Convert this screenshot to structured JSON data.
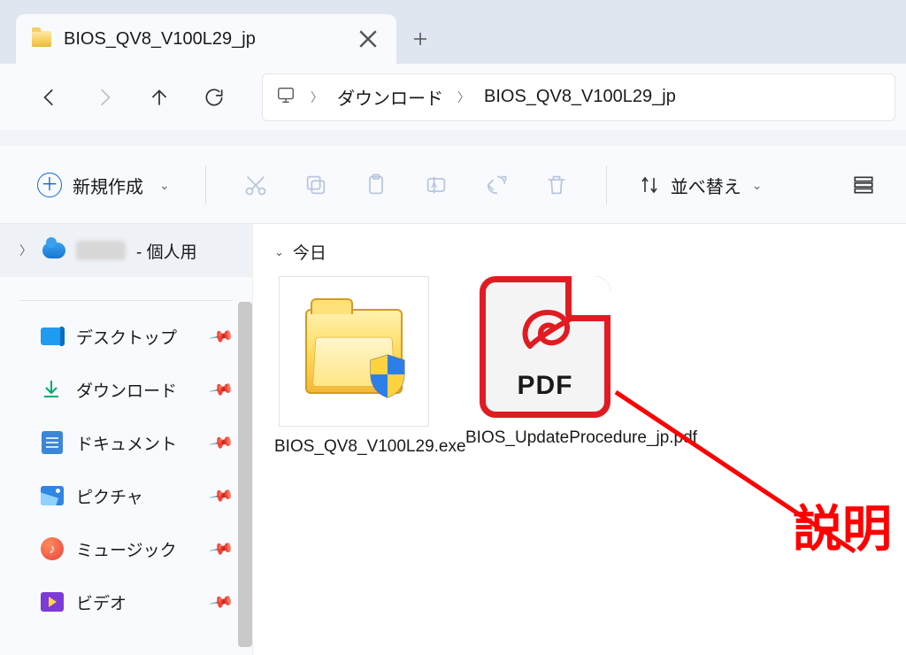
{
  "tab": {
    "title": "BIOS_QV8_V100L29_jp"
  },
  "breadcrumb": {
    "root_icon": "monitor-icon",
    "items": [
      "ダウンロード",
      "BIOS_QV8_V100L29_jp"
    ]
  },
  "toolbar": {
    "new_label": "新規作成",
    "sort_label": "並べ替え"
  },
  "navpane": {
    "top_label": "- 個人用",
    "items": [
      {
        "label": "デスクトップ",
        "icon": "desktop"
      },
      {
        "label": "ダウンロード",
        "icon": "download"
      },
      {
        "label": "ドキュメント",
        "icon": "document"
      },
      {
        "label": "ピクチャ",
        "icon": "picture"
      },
      {
        "label": "ミュージック",
        "icon": "music"
      },
      {
        "label": "ビデオ",
        "icon": "video"
      }
    ]
  },
  "content": {
    "group_label": "今日",
    "files": [
      {
        "name": "BIOS_QV8_V100L29.exe",
        "kind": "exe"
      },
      {
        "name": "BIOS_UpdateProcedure_jp.pdf",
        "kind": "pdf"
      }
    ],
    "pdf_badge": "PDF"
  },
  "annotation": {
    "label": "説明"
  }
}
